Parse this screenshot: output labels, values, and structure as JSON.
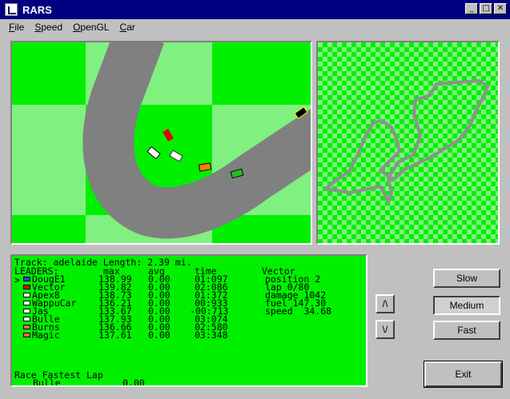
{
  "window": {
    "title": "RARS"
  },
  "window_controls": {
    "minimize": "_",
    "maximize": "□",
    "close": "✕"
  },
  "menu": [
    {
      "label_underline": "F",
      "label_rest": "ile"
    },
    {
      "label_underline": "S",
      "label_rest": "peed"
    },
    {
      "label_underline": "O",
      "label_rest": "penGL"
    },
    {
      "label_underline": "C",
      "label_rest": "ar"
    }
  ],
  "info": {
    "track_line": "Track: adelaide Length: 2.39 mi.",
    "headers": {
      "leaders": "LEADERS:",
      "max": "max",
      "avg": "avg",
      "time": "time"
    },
    "selected_marker": ">",
    "leaders": [
      {
        "name": "DougE1",
        "max": "138.99",
        "avg": "0.00",
        "time": "01:097",
        "color": "#2040ff"
      },
      {
        "name": "Vector",
        "max": "139.82",
        "avg": "0.00",
        "time": "02:086",
        "color": "#e00000"
      },
      {
        "name": "Apex8",
        "max": "138.73",
        "avg": "0.00",
        "time": "01:372",
        "color": "#ffffff"
      },
      {
        "name": "WappuCar",
        "max": "136.21",
        "avg": "0.00",
        "time": "00:933",
        "color": "#ffffff"
      },
      {
        "name": "Jas",
        "max": "133.67",
        "avg": "0.00",
        "time": "-00:713",
        "color": "#ffffff"
      },
      {
        "name": "Bulle",
        "max": "137.93",
        "avg": "0.00",
        "time": "03:074",
        "color": "#ffffff"
      },
      {
        "name": "Burns",
        "max": "136.66",
        "avg": "0.00",
        "time": "02:580",
        "color": "#ff6060"
      },
      {
        "name": "Magic",
        "max": "137.61",
        "avg": "0.00",
        "time": "03:348",
        "color": "#ff6060"
      }
    ],
    "car_status": {
      "name": "Vector",
      "position": "position 2",
      "lap": "lap 0/80",
      "damage": "damage 1042",
      "fuel": "fuel 147.30",
      "speed": "speed  34.68"
    },
    "fastest_lap_title": "Race Fastest Lap",
    "fastest_lap_driver": "Bulle",
    "fastest_lap_value": "0.00"
  },
  "buttons": {
    "up": "/\\",
    "down": "\\/",
    "slow": "Slow",
    "medium": "Medium",
    "fast": "Fast",
    "exit": "Exit"
  },
  "colors": {
    "checker_dark": "#00f000",
    "checker_light": "#80f080",
    "track": "#808080",
    "title_bar": "#000080",
    "info_bg": "#00f000"
  }
}
